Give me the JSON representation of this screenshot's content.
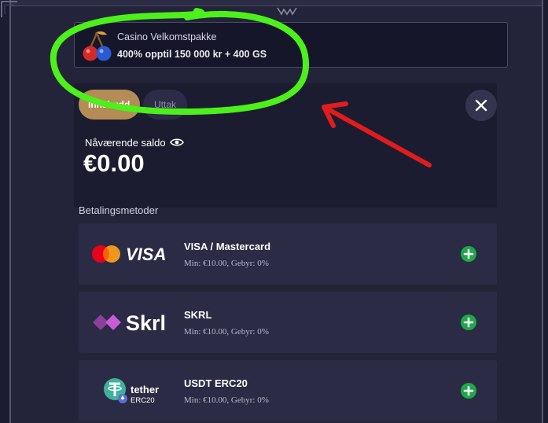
{
  "promo": {
    "title": "Casino Velkomstpakke",
    "description": "400% opptil 150 000 kr + 400 GS",
    "icon": "cherries-icon"
  },
  "tabs": {
    "deposit": "Innskudd",
    "withdraw": "Uttak"
  },
  "balance": {
    "label": "Nåværende saldo",
    "value": "€0.00"
  },
  "payment": {
    "section_label": "Betalingsmetoder",
    "methods": [
      {
        "name": "VISA / Mastercard",
        "meta": "Min: €10.00, Gebyr: 0%",
        "logo_text": "VISA"
      },
      {
        "name": "SKRL",
        "meta": "Min: €10.00, Gebyr: 0%",
        "logo_text": "Skrl"
      },
      {
        "name": "USDT ERC20",
        "meta": "Min: €10.00, Gebyr: 0%",
        "logo_text": "tether",
        "logo_sub": "ERC20"
      }
    ]
  },
  "colors": {
    "deposit_tab": "#b48c55",
    "add_button": "#1fa84a",
    "annotation_circle": "#4cf01a",
    "annotation_arrow": "#e01c1c",
    "skrill_purple": "#8b3f9a",
    "tether_teal": "#3db39a"
  }
}
